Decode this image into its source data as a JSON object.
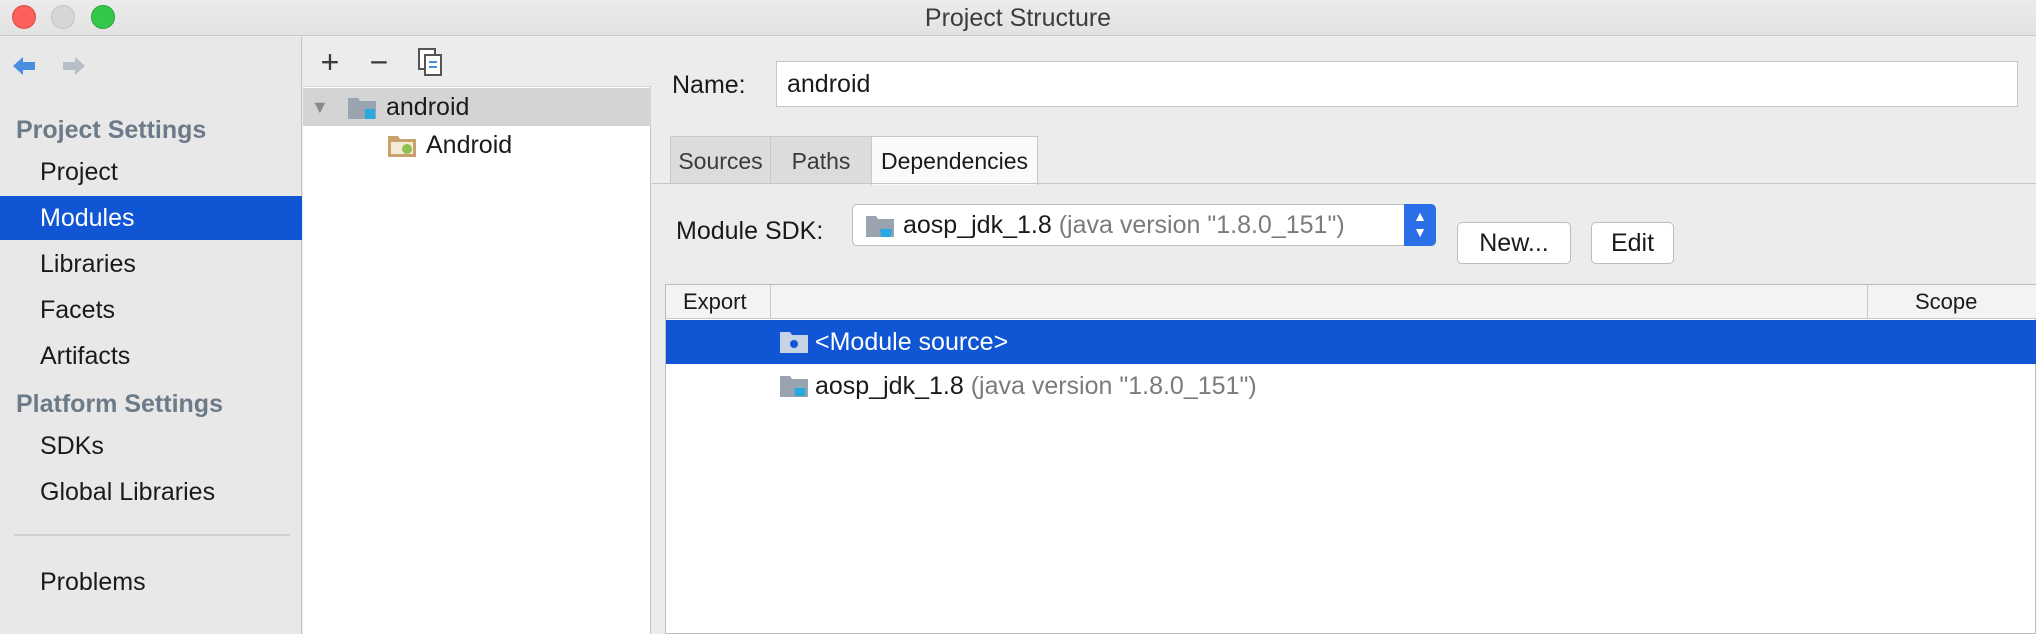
{
  "window": {
    "title": "Project Structure"
  },
  "sidebar": {
    "project_settings_header": "Project Settings",
    "project_items": [
      "Project",
      "Modules",
      "Libraries",
      "Facets",
      "Artifacts"
    ],
    "platform_settings_header": "Platform Settings",
    "platform_items": [
      "SDKs",
      "Global Libraries"
    ],
    "problems": "Problems",
    "selected": "Modules"
  },
  "tree": {
    "toolbar": {
      "add": "+",
      "remove": "−"
    },
    "module": "android",
    "facet": "Android"
  },
  "main": {
    "name_label": "Name:",
    "name_value": "android",
    "tabs": [
      "Sources",
      "Paths",
      "Dependencies"
    ],
    "active_tab": "Dependencies",
    "sdk_label": "Module SDK:",
    "sdk_name": "aosp_jdk_1.8",
    "sdk_version": "(java version \"1.8.0_151\")",
    "new_button": "New...",
    "edit_button": "Edit",
    "table": {
      "headers": [
        "Export",
        "",
        "Scope"
      ],
      "rows": [
        {
          "name": "<Module source>",
          "detail": ""
        },
        {
          "name": "aosp_jdk_1.8",
          "detail": "(java version \"1.8.0_151\")"
        }
      ]
    }
  },
  "colors": {
    "selection": "#0f55d4",
    "stepper": "#2a6fe8",
    "section_header": "#6d7a89",
    "close": "#fc605c",
    "maximize": "#34c84a"
  }
}
